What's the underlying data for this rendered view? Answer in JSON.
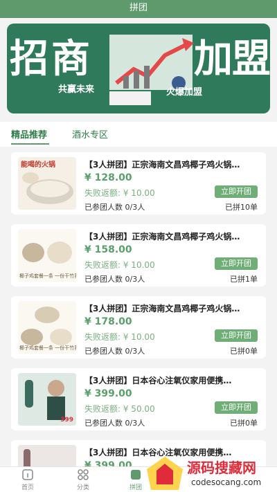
{
  "header": {
    "title": "拼团"
  },
  "banner": {
    "chars": [
      "招",
      "商",
      "加",
      "盟"
    ],
    "left_sub": "共赢未来",
    "right_sub": "火爆加盟"
  },
  "tabs": [
    {
      "label": "精品推荐",
      "active": true
    },
    {
      "label": "酒水专区",
      "active": false
    }
  ],
  "items": [
    {
      "title": "【3人拼团】正宗海南文昌鸡椰子鸡火锅…",
      "price": "¥ 128.00",
      "refund": "失败返额: ¥ 10.00",
      "joined": "已参团人数 0/3人",
      "button": "立即开团",
      "sold": "已拼10单",
      "thumb_text": "能喝的火锅"
    },
    {
      "title": "【3人拼团】正宗海南文昌鸡椰子鸡火锅…",
      "price": "¥ 158.00",
      "refund": "失败返额: ¥ 10.00",
      "joined": "已参团人数 0/3人",
      "button": "立即开团",
      "sold": "已拼1单",
      "thumb_text": "椰子鸡套餐一条 一份干竹荪"
    },
    {
      "title": "【3人拼团】正宗海南文昌鸡椰子鸡火锅…",
      "price": "¥ 178.00",
      "refund": "失败返额: ¥ 10.00",
      "joined": "已参团人数 0/3人",
      "button": "立即开团",
      "sold": "已拼0单",
      "thumb_text": "椰子鸡套餐一条 一份干竹荪"
    },
    {
      "title": "【3人拼团】日本谷心注氧仪家用便携…",
      "price": "¥ 399.00",
      "refund": "失败返额: ¥ 50.00",
      "joined": "已参团人数 0/3人",
      "button": "立即开团",
      "sold": "已拼0单",
      "thumb_text": "399"
    },
    {
      "title": "【3人拼团】日本谷心注氧仪家用便携…",
      "price": "¥ 399.00",
      "refund": "",
      "joined": "",
      "button": "",
      "sold": "",
      "thumb_text": ""
    }
  ],
  "bottom_nav": [
    {
      "label": "首页",
      "icon": "home-icon"
    },
    {
      "label": "分类",
      "icon": "category-icon"
    },
    {
      "label": "拼团",
      "icon": "group-buy-icon"
    }
  ],
  "watermark": {
    "text": "源码搜藏网",
    "url": "codesocang.com"
  },
  "colors": {
    "primary": "#5e9a6b",
    "price": "#5aa06a",
    "banner": "#2f7a5a",
    "watermark": "#e02c3a"
  }
}
